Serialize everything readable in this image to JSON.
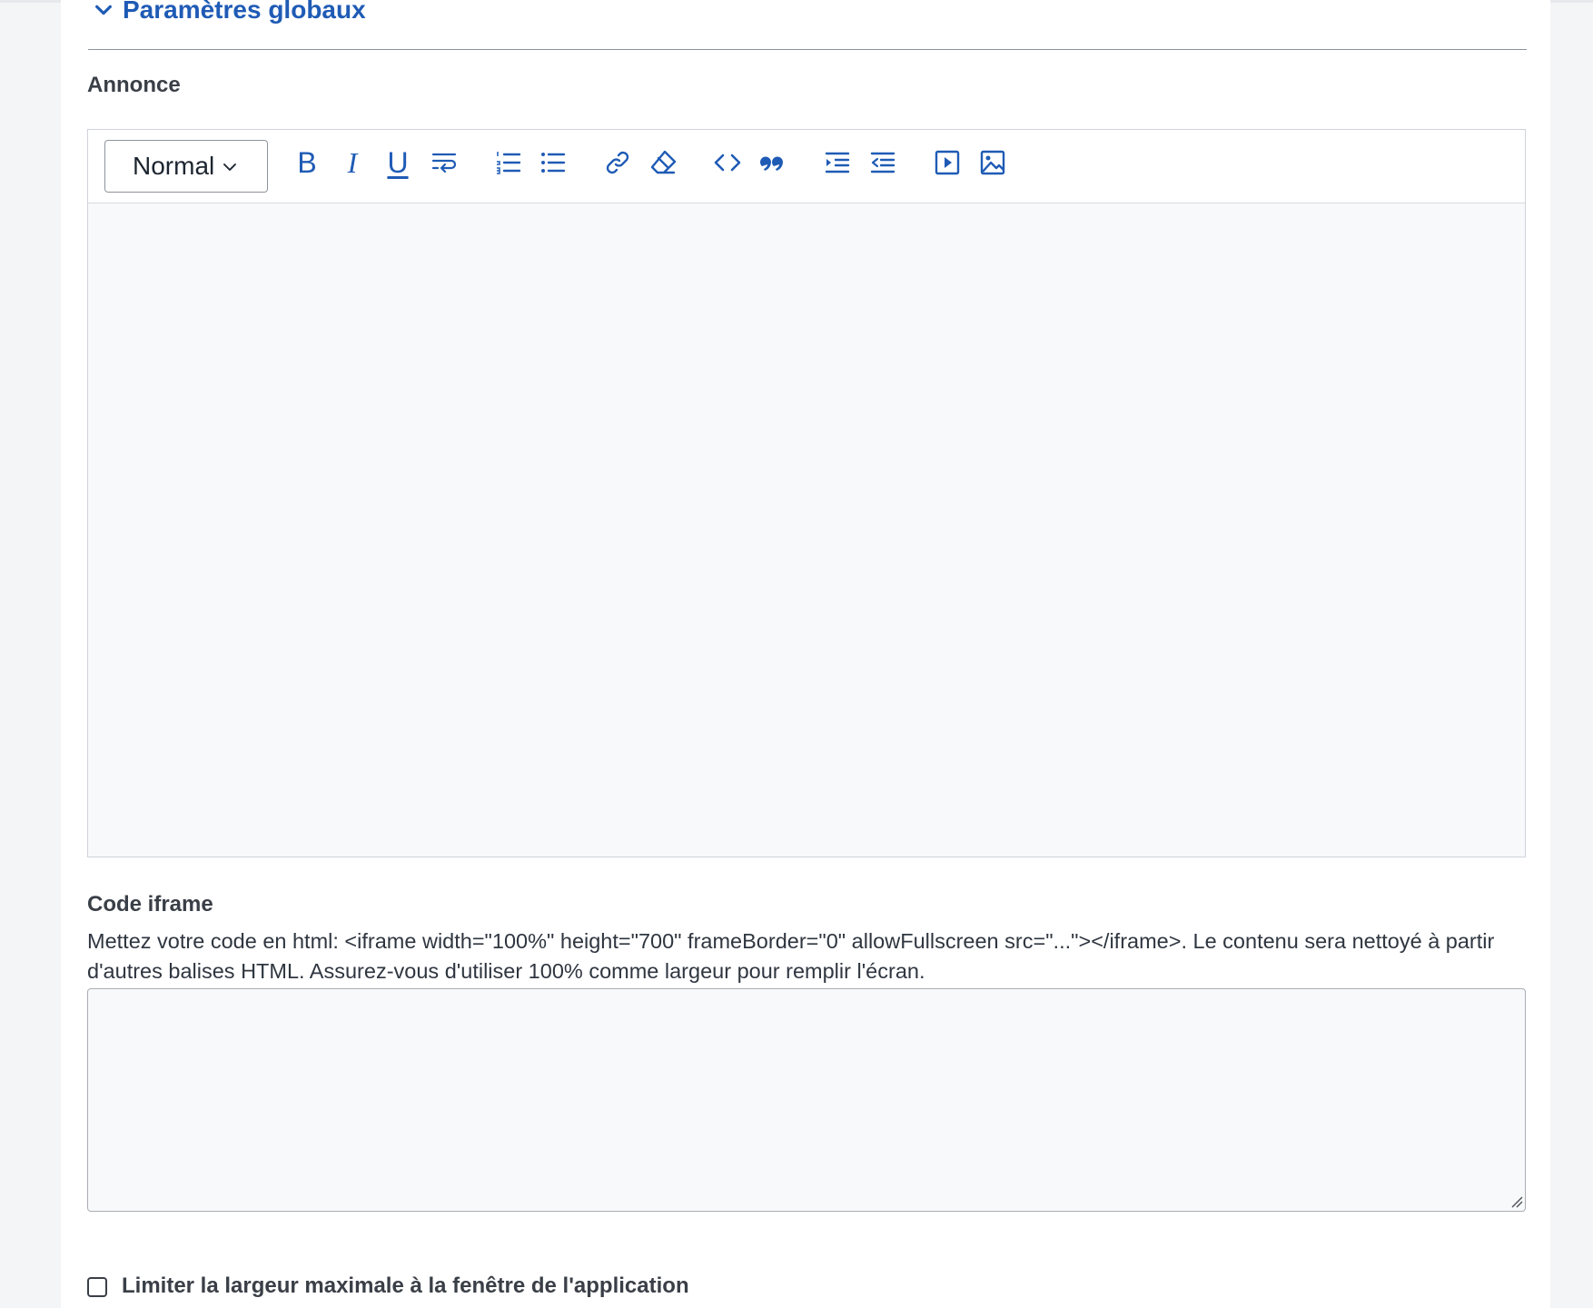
{
  "section": {
    "title": "Paramètres globaux"
  },
  "announcement": {
    "label": "Annonce",
    "toolbar": {
      "style_select": "Normal",
      "bold": "B",
      "italic": "I",
      "underline": "U"
    }
  },
  "iframe": {
    "label": "Code iframe",
    "help": "Mettez votre code en html: <iframe width=\"100%\" height=\"700\" frameBorder=\"0\" allowFullscreen src=\"...\"></iframe>. Le contenu sera nettoyé à partir d'autres balises HTML. Assurez-vous d'utiliser 100% comme largeur pour remplir l'écran.",
    "value": ""
  },
  "limit_width": {
    "label": "Limiter la largeur maximale à la fenêtre de l'application",
    "checked": false
  },
  "colors": {
    "accent": "#1f5bb5",
    "text": "#2c3440",
    "editor_bg": "#f8f9fb"
  },
  "icons": {
    "toolbar": [
      "bold-icon",
      "italic-icon",
      "underline-icon",
      "wrap-text-icon",
      "ordered-list-icon",
      "bullet-list-icon",
      "link-icon",
      "clear-format-icon",
      "code-icon",
      "quote-icon",
      "indent-icon",
      "outdent-icon",
      "video-icon",
      "image-icon"
    ]
  }
}
